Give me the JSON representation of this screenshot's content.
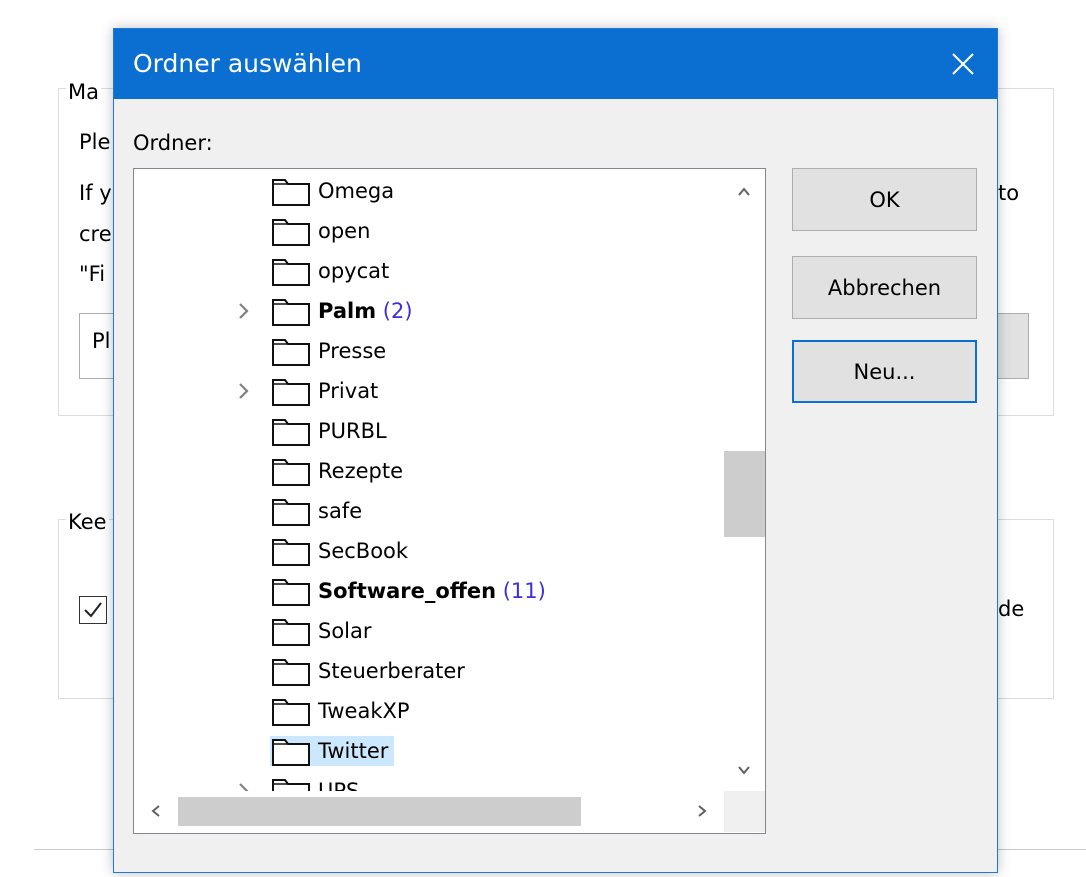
{
  "background": {
    "group1_legend": "Ma",
    "line1": "Ple",
    "line2a": "If y",
    "line2b": "cre",
    "line2c": "\"Fi",
    "line2_right": "to",
    "input_text": "Pl",
    "group2_legend": "Kee",
    "check_right": "de"
  },
  "dialog": {
    "title": "Ordner auswählen",
    "close_icon": "close-icon",
    "ordner_label": "Ordner:",
    "folders": [
      {
        "name": "Omega",
        "count": "",
        "bold": false,
        "expandable": false,
        "selected": false
      },
      {
        "name": "open",
        "count": "",
        "bold": false,
        "expandable": false,
        "selected": false
      },
      {
        "name": "opycat",
        "count": "",
        "bold": false,
        "expandable": false,
        "selected": false
      },
      {
        "name": "Palm",
        "count": "(2)",
        "bold": true,
        "expandable": true,
        "selected": false
      },
      {
        "name": "Presse",
        "count": "",
        "bold": false,
        "expandable": false,
        "selected": false
      },
      {
        "name": "Privat",
        "count": "",
        "bold": false,
        "expandable": true,
        "selected": false
      },
      {
        "name": "PURBL",
        "count": "",
        "bold": false,
        "expandable": false,
        "selected": false
      },
      {
        "name": "Rezepte",
        "count": "",
        "bold": false,
        "expandable": false,
        "selected": false
      },
      {
        "name": "safe",
        "count": "",
        "bold": false,
        "expandable": false,
        "selected": false
      },
      {
        "name": "SecBook",
        "count": "",
        "bold": false,
        "expandable": false,
        "selected": false
      },
      {
        "name": "Software_offen",
        "count": "(11)",
        "bold": true,
        "expandable": false,
        "selected": false
      },
      {
        "name": "Solar",
        "count": "",
        "bold": false,
        "expandable": false,
        "selected": false
      },
      {
        "name": "Steuerberater",
        "count": "",
        "bold": false,
        "expandable": false,
        "selected": false
      },
      {
        "name": "TweakXP",
        "count": "",
        "bold": false,
        "expandable": false,
        "selected": false
      },
      {
        "name": "Twitter",
        "count": "",
        "bold": false,
        "expandable": false,
        "selected": true
      },
      {
        "name": "UPS",
        "count": "",
        "bold": false,
        "expandable": true,
        "selected": false
      }
    ],
    "buttons": {
      "ok": "OK",
      "cancel": "Abbrechen",
      "new": "Neu..."
    },
    "colors": {
      "title_bar": "#0a6fd0",
      "selection": "#cce8ff",
      "count": "#3f2fd8"
    }
  }
}
